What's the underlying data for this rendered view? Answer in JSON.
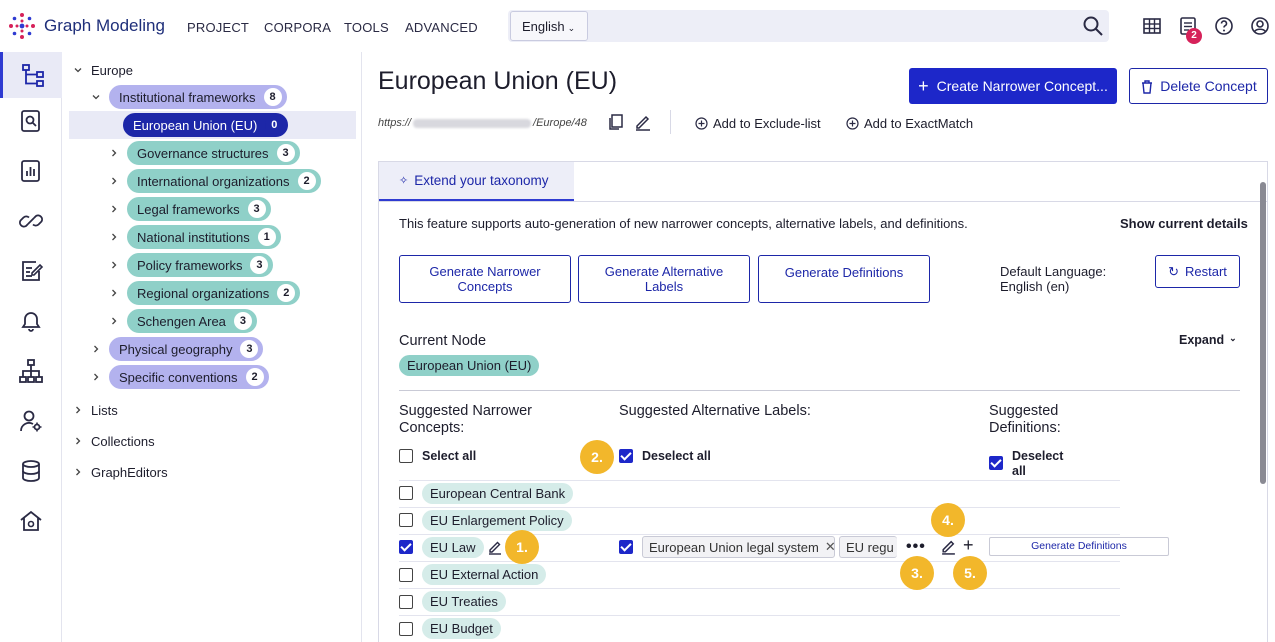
{
  "app": {
    "title": "Graph Modeling",
    "menu": [
      "PROJECT",
      "CORPORA",
      "TOOLS",
      "ADVANCED"
    ],
    "language": "English",
    "notification_count": "2"
  },
  "rail_icons": [
    "taxonomy-icon",
    "search-document-icon",
    "reports-icon",
    "linking-icon",
    "edit-list-icon",
    "notifications-icon",
    "hierarchy-icon",
    "user-settings-icon",
    "database-icon",
    "home-settings-icon"
  ],
  "tree": {
    "root": "Europe",
    "institutional": {
      "label": "Institutional frameworks",
      "count": "8"
    },
    "selected": {
      "label": "European Union (EU)",
      "count": "0"
    },
    "children": [
      {
        "label": "Governance structures",
        "count": "3"
      },
      {
        "label": "International organizations",
        "count": "2"
      },
      {
        "label": "Legal frameworks",
        "count": "3"
      },
      {
        "label": "National institutions",
        "count": "1"
      },
      {
        "label": "Policy frameworks",
        "count": "3"
      },
      {
        "label": "Regional organizations",
        "count": "2"
      },
      {
        "label": "Schengen Area",
        "count": "3"
      }
    ],
    "siblings": [
      {
        "label": "Physical geography",
        "count": "3"
      },
      {
        "label": "Specific conventions",
        "count": "2"
      }
    ],
    "top_level": [
      "Lists",
      "Collections",
      "GraphEditors"
    ]
  },
  "concept": {
    "title": "European Union (EU)",
    "create_label": "Create Narrower Concept...",
    "delete_label": "Delete Concept",
    "uri_prefix": "https://",
    "uri_suffix": "/Europe/48",
    "add_exclude": "Add to Exclude-list",
    "add_exactmatch": "Add to ExactMatch"
  },
  "extend": {
    "tab_label": "Extend your taxonomy",
    "description": "This feature supports auto-generation of new narrower concepts, alternative labels, and definitions.",
    "show_details": "Show current details",
    "btn_narrower": "Generate Narrower Concepts",
    "btn_altlabels": "Generate Alternative Labels",
    "btn_definitions": "Generate Definitions",
    "default_language": "Default Language: English (en)",
    "restart": "Restart",
    "current_node_label": "Current Node",
    "current_node": "European Union (EU)",
    "expand": "Expand",
    "col_narrower": "Suggested Narrower Concepts:",
    "col_altlabels": "Suggested Alternative Labels:",
    "col_definitions": "Suggested Definitions:",
    "select_all": "Select all",
    "deselect_all": "Deselect all",
    "deselect_all_def": "Deselect all",
    "suggestions": [
      {
        "label": "European Central Bank",
        "checked": false
      },
      {
        "label": "EU Enlargement Policy",
        "checked": false
      },
      {
        "label": "EU Law",
        "checked": true
      },
      {
        "label": "EU External Action",
        "checked": false
      },
      {
        "label": "EU Treaties",
        "checked": false
      },
      {
        "label": "EU Budget",
        "checked": false
      }
    ],
    "alt_chip_1": "European Union legal system",
    "alt_chip_2": "EU regu",
    "gen_def_small": "Generate Definitions"
  },
  "callouts": [
    "1.",
    "2.",
    "3.",
    "4.",
    "5."
  ],
  "colors": {
    "primary": "#1d27c9",
    "callout": "#f2b72b",
    "teal_pill": "#8fd0c8",
    "purple_pill": "#b3b2ee"
  }
}
